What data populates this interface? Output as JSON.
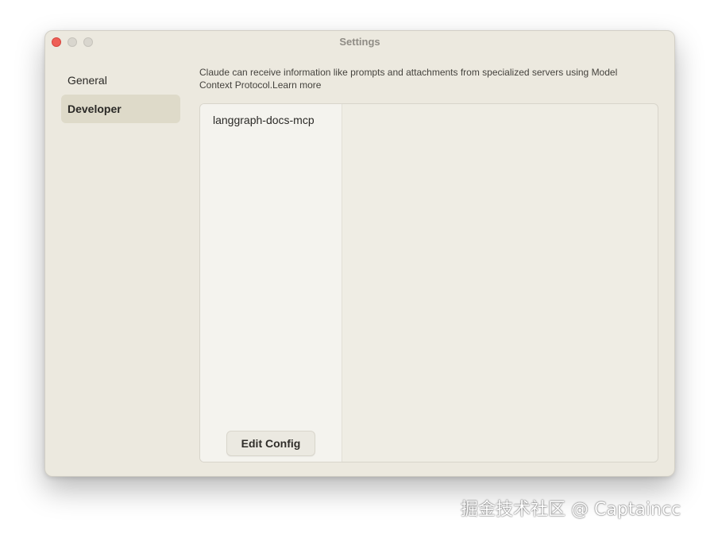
{
  "window": {
    "title": "Settings"
  },
  "sidebar": {
    "items": [
      {
        "label": "General",
        "active": false
      },
      {
        "label": "Developer",
        "active": true
      }
    ]
  },
  "developer": {
    "description": "Claude can receive information like prompts and attachments from specialized servers using Model Context Protocol.",
    "learn_more": "Learn more",
    "servers": [
      {
        "name": "langgraph-docs-mcp"
      }
    ],
    "edit_config_label": "Edit Config"
  },
  "watermark": "掘金技术社区 @ Captaincc",
  "colors": {
    "close_button": "#ee5f57",
    "window_bg": "#ece9df",
    "active_item_bg": "#dedac9"
  },
  "icons": {
    "close": "close-icon",
    "minimize": "minimize-icon",
    "zoom": "zoom-icon"
  }
}
